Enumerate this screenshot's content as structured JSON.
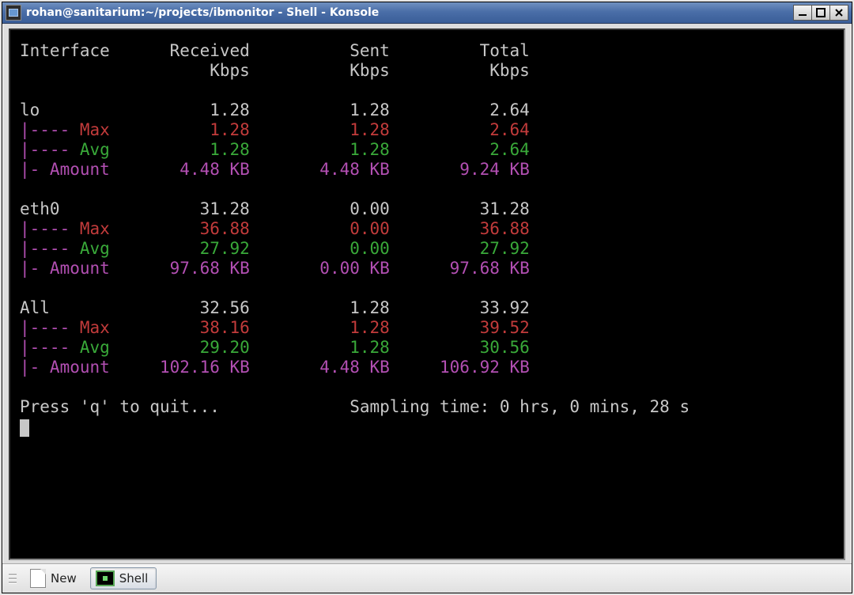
{
  "window": {
    "title": "rohan@sanitarium:~/projects/ibmonitor - Shell - Konsole"
  },
  "headers": {
    "col0": "Interface",
    "recv": "Received",
    "sent": "Sent",
    "total": "Total",
    "unit": "Kbps"
  },
  "row_labels": {
    "max": "|---- Max",
    "avg": "|---- Avg",
    "amount": "|- Amount"
  },
  "interfaces": [
    {
      "name": "lo",
      "current": {
        "recv": "1.28",
        "sent": "1.28",
        "total": "2.64"
      },
      "max": {
        "recv": "1.28",
        "sent": "1.28",
        "total": "2.64"
      },
      "avg": {
        "recv": "1.28",
        "sent": "1.28",
        "total": "2.64"
      },
      "amount": {
        "recv": "4.48 KB",
        "sent": "4.48 KB",
        "total": "9.24 KB"
      }
    },
    {
      "name": "eth0",
      "current": {
        "recv": "31.28",
        "sent": "0.00",
        "total": "31.28"
      },
      "max": {
        "recv": "36.88",
        "sent": "0.00",
        "total": "36.88"
      },
      "avg": {
        "recv": "27.92",
        "sent": "0.00",
        "total": "27.92"
      },
      "amount": {
        "recv": "97.68 KB",
        "sent": "0.00 KB",
        "total": "97.68 KB"
      }
    },
    {
      "name": "All",
      "current": {
        "recv": "32.56",
        "sent": "1.28",
        "total": "33.92"
      },
      "max": {
        "recv": "38.16",
        "sent": "1.28",
        "total": "39.52"
      },
      "avg": {
        "recv": "29.20",
        "sent": "1.28",
        "total": "30.56"
      },
      "amount": {
        "recv": "102.16 KB",
        "sent": "4.48 KB",
        "total": "106.92 KB"
      }
    }
  ],
  "footer": {
    "quit": "Press 'q' to quit...",
    "sampling_label": "Sampling time:",
    "sampling_value": "0 hrs, 0 mins, 28 s"
  },
  "toolbar": {
    "new_label": "New",
    "shell_label": "Shell"
  },
  "colors": {
    "gray": "#c8c8c8",
    "red": "#c23b3b",
    "green": "#39a939",
    "magenta": "#b24fb2"
  }
}
